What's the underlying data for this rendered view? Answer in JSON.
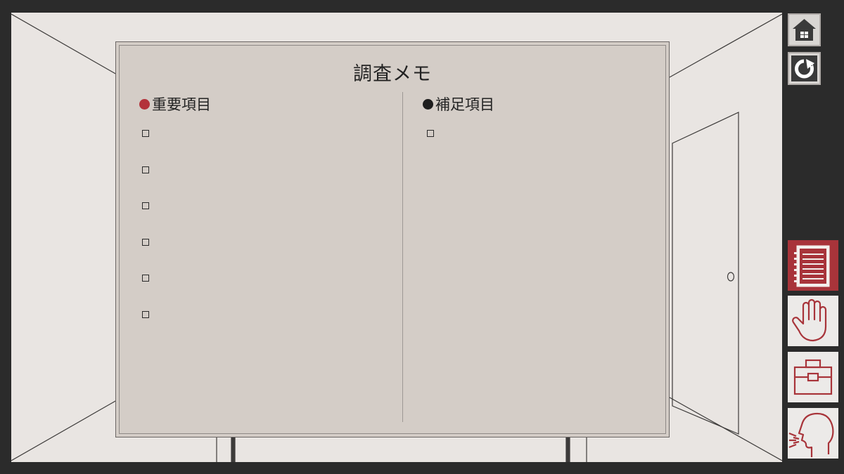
{
  "memo": {
    "title": "調査メモ",
    "important": {
      "label": "重要項目",
      "bullet_color": "#b3323a",
      "items": [
        "",
        "",
        "",
        "",
        "",
        ""
      ]
    },
    "supplementary": {
      "label": "補足項目",
      "bullet_color": "#1e1e1e",
      "items": [
        ""
      ]
    }
  },
  "toolbar": {
    "top": [
      "home-icon",
      "restart-icon"
    ],
    "actions": [
      {
        "name": "memo-notebook-icon",
        "active": true
      },
      {
        "name": "hand-icon",
        "active": false
      },
      {
        "name": "briefcase-icon",
        "active": false
      },
      {
        "name": "talk-icon",
        "active": false
      }
    ]
  },
  "colors": {
    "accent": "#a8343a",
    "frame": "#2b2b2b",
    "wall": "#e9e5e2",
    "board": "#d4cdc7"
  }
}
